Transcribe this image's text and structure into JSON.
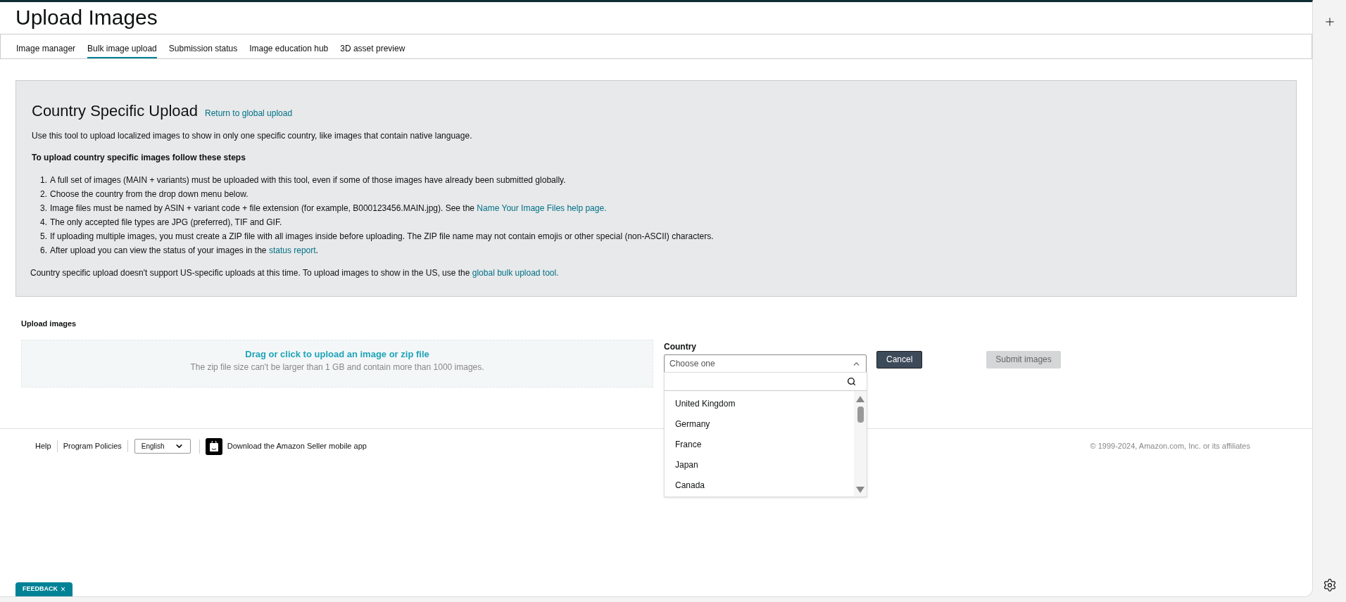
{
  "page_title": "Upload Images",
  "tabs": [
    {
      "label": "Image manager",
      "selected": false
    },
    {
      "label": "Bulk image upload",
      "selected": true
    },
    {
      "label": "Submission status",
      "selected": false
    },
    {
      "label": "Image education hub",
      "selected": false
    },
    {
      "label": "3D asset preview",
      "selected": false
    }
  ],
  "info": {
    "title": "Country Specific Upload",
    "title_link": "Return to global upload",
    "intro": "Use this tool to upload localized images to show in only one specific country, like images that contain native language.",
    "steps_heading": "To upload country specific images follow these steps",
    "steps": [
      {
        "number": "1.",
        "text": "A full set of images (MAIN + variants) must be uploaded with this tool, even if some of those images have already been submitted globally."
      },
      {
        "number": "2.",
        "text": "Choose the country from the drop down menu below."
      },
      {
        "number": "3.",
        "text": "Image files must be named by ASIN + variant code + file extension (for example, B000123456.MAIN.jpg). See the",
        "link": "Name Your Image Files help page."
      },
      {
        "number": "4.",
        "text": "The only accepted file types are JPG (preferred), TIF and GIF."
      },
      {
        "number": "5.",
        "text": "If uploading multiple images, you must create a ZIP file with all images inside before uploading. The ZIP file name may not contain emojis or other special (non-ASCII) characters."
      },
      {
        "number": "6.",
        "text": "After upload you can view the status of your images in the",
        "link": "status report",
        "after": "."
      }
    ],
    "note": "Country specific upload doesn't support US-specific uploads at this time. To upload images to show in the US, use the",
    "note_link": "global bulk upload tool."
  },
  "upload": {
    "label": "Upload images",
    "drop_title": "Drag or click to upload an image or zip file",
    "drop_hint": "The zip file size can't be larger than 1 GB and contain more than 1000 images."
  },
  "country": {
    "label": "Country",
    "placeholder": "Choose one",
    "expanded": true,
    "options": [
      "United Kingdom",
      "Germany",
      "France",
      "Japan",
      "Canada"
    ]
  },
  "buttons": [
    {
      "label": "Cancel",
      "disabled": false
    },
    {
      "label": "Submit images",
      "disabled": true
    }
  ],
  "footer": {
    "links": [
      "Help",
      "Program Policies"
    ],
    "language": "English",
    "app_link": "Download the Amazon Seller mobile app",
    "copyright": "© 1999-2024, Amazon.com, Inc. or its affiliates"
  },
  "feedback": {
    "label": "FEEDBACK",
    "close": "×"
  }
}
